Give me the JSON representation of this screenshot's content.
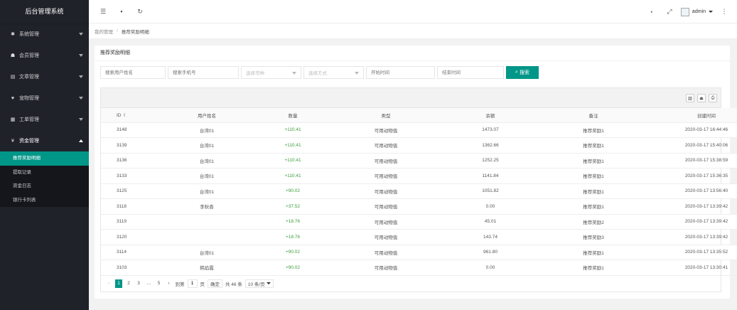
{
  "app": {
    "title": "后台管理系统"
  },
  "sidebar": {
    "items": [
      {
        "label": "系统管理",
        "icon": "gear-icon",
        "glyph": "✱"
      },
      {
        "label": "会员管理",
        "icon": "users-icon",
        "glyph": "☗"
      },
      {
        "label": "文章管理",
        "icon": "article-icon",
        "glyph": "▤"
      },
      {
        "label": "宠物管理",
        "icon": "heart-icon",
        "glyph": "♥"
      },
      {
        "label": "工单管理",
        "icon": "ticket-icon",
        "glyph": "▦"
      },
      {
        "label": "资金管理",
        "icon": "yen-icon",
        "glyph": "¥"
      }
    ],
    "submenu": [
      "推荐奖励明细",
      "提取记录",
      "资金日志",
      "银行卡列表"
    ]
  },
  "header": {
    "user": "admin"
  },
  "breadcrumb": {
    "home": "我的管理",
    "current": "推荐奖励明细"
  },
  "card": {
    "title": "推荐奖励明细"
  },
  "search": {
    "username_placeholder": "搜索用户姓名",
    "phone_placeholder": "搜索手机号",
    "currency_placeholder": "选择币种",
    "method_placeholder": "选择方式",
    "start_placeholder": "开始时间",
    "end_placeholder": "结束时间",
    "button_label": "搜索"
  },
  "table": {
    "columns": [
      "ID",
      "用户姓名",
      "数量",
      "类型",
      "余额",
      "备注",
      "创建时间"
    ],
    "rows": [
      [
        "3148",
        "台湾01",
        "+110.41",
        "可用动物值",
        "1473.07",
        "推荐奖励1",
        "2020-03-17 16:44:46"
      ],
      [
        "3139",
        "台湾01",
        "+110.41",
        "可用动物值",
        "1362.66",
        "推荐奖励1",
        "2020-03-17 15:40:06"
      ],
      [
        "3136",
        "台湾01",
        "+110.41",
        "可用动物值",
        "1252.25",
        "推荐奖励1",
        "2020-03-17 15:38:59"
      ],
      [
        "3133",
        "台湾01",
        "+110.41",
        "可用动物值",
        "1141.84",
        "推荐奖励1",
        "2020-03-17 15:36:35"
      ],
      [
        "3125",
        "台湾01",
        "+90.02",
        "可用动物值",
        "1051.82",
        "推荐奖励1",
        "2020-03-17 13:56:40"
      ],
      [
        "3118",
        "李秋香",
        "+37.52",
        "可用动物值",
        "0.00",
        "推荐奖励1",
        "2020-03-17 13:39:42"
      ],
      [
        "3119",
        "",
        "+18.76",
        "可用动物值",
        "45.01",
        "推荐奖励2",
        "2020-03-17 13:39:42"
      ],
      [
        "3120",
        "",
        "+18.76",
        "可用动物值",
        "143.74",
        "推荐奖励3",
        "2020-03-17 13:39:42"
      ],
      [
        "3114",
        "台湾01",
        "+90.02",
        "可用动物值",
        "961.80",
        "推荐奖励1",
        "2020-03-17 13:35:52"
      ],
      [
        "3103",
        "韩焰霞",
        "+90.02",
        "可用动物值",
        "0.00",
        "推荐奖励1",
        "2020-03-17 13:30:41"
      ]
    ]
  },
  "pager": {
    "pages": [
      "1",
      "2",
      "3",
      "…",
      "5"
    ],
    "goto_label": "到第",
    "goto_value": "1",
    "page_unit": "页",
    "confirm_label": "确定",
    "total": "共 46 条",
    "page_size": "10 条/页"
  }
}
